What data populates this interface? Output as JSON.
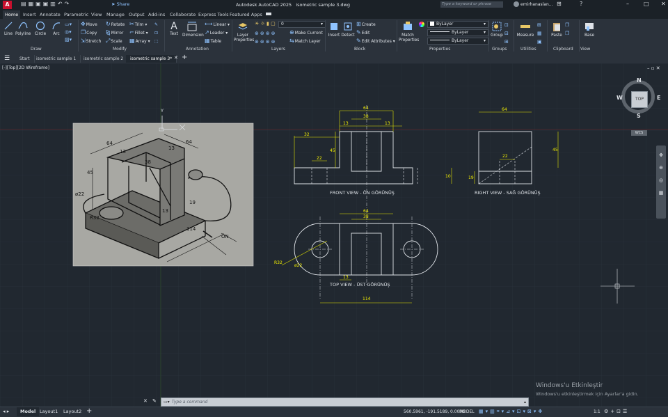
{
  "titlebar": {
    "app_title": "Autodesk AutoCAD 2025",
    "file_name": "isometric sample 3.dwg",
    "share_label": "Share",
    "search_placeholder": "Type a keyword or phrase",
    "user": "emirhanaslan..."
  },
  "ribbon_tabs": [
    "Home",
    "Insert",
    "Annotate",
    "Parametric",
    "View",
    "Manage",
    "Output",
    "Add-ins",
    "Collaborate",
    "Express Tools",
    "Featured Apps"
  ],
  "active_ribbon_tab": "Home",
  "draw": {
    "line": "Line",
    "polyline": "Polyline",
    "circle": "Circle",
    "arc": "Arc",
    "panel": "Draw"
  },
  "modify": {
    "move": "Move",
    "rotate": "Rotate",
    "trim": "Trim",
    "copy": "Copy",
    "mirror": "Mirror",
    "fillet": "Fillet",
    "stretch": "Stretch",
    "scale": "Scale",
    "array": "Array",
    "panel": "Modify"
  },
  "annotation": {
    "text": "Text",
    "dimension": "Dimension",
    "linear": "Linear",
    "leader": "Leader",
    "table": "Table",
    "panel": "Annotation"
  },
  "layers": {
    "layer_properties_1": "Layer",
    "layer_properties_2": "Properties",
    "current_layer": "0",
    "make_current": "Make Current",
    "match_layer": "Match Layer",
    "panel": "Layers"
  },
  "block": {
    "insert": "Insert",
    "detect": "Detect",
    "create": "Create",
    "edit": "Edit",
    "edit_attributes": "Edit Attributes",
    "panel": "Block"
  },
  "properties": {
    "match_1": "Match",
    "match_2": "Properties",
    "color": "ByLayer",
    "linetype": "ByLayer",
    "lineweight": "ByLayer",
    "panel": "Properties"
  },
  "groups": {
    "group": "Group",
    "panel": "Groups"
  },
  "utilities": {
    "measure": "Measure",
    "panel": "Utilities"
  },
  "clipboard": {
    "paste": "Paste",
    "panel": "Clipboard"
  },
  "view_panel": {
    "base": "Base",
    "panel": "View"
  },
  "doc_tabs": [
    "Start",
    "isometric sample 1",
    "isometric sample 2",
    "isometric sample 3*"
  ],
  "active_doc_tab": "isometric sample 3*",
  "viewport_label": "[-][Top][2D Wireframe]",
  "viewcube": {
    "top": "TOP",
    "n": "N",
    "s": "S",
    "e": "E",
    "w": "W",
    "wcs": "WCS"
  },
  "drawing": {
    "front_view": "FRONT VIEW - ÖN GÖRÜNÜŞ",
    "right_view": "RIGHT VIEW - SAĞ GÖRÜNÜŞ",
    "top_view": "TOP VIEW - ÜST GÖRÜNÜŞ",
    "dims_front": {
      "d64": "64",
      "d38": "38",
      "d13a": "13",
      "d13b": "13",
      "d32": "32",
      "d45": "45",
      "d22": "22",
      "d10": "10"
    },
    "dims_right": {
      "d64": "64",
      "d45": "45",
      "d22": "22",
      "d19": "19"
    },
    "dims_top": {
      "d64": "64",
      "d38": "38",
      "d13": "13",
      "d114": "114",
      "r32": "R32",
      "phi22": "ø22"
    },
    "iso_dims": {
      "d64a": "64",
      "d13a": "13",
      "d38": "38",
      "d13b": "13",
      "d64b": "64",
      "d45": "45",
      "phi22": "ø22",
      "r32": "R32",
      "d13c": "13",
      "d19": "19",
      "d114": "114",
      "on": "ÖN"
    }
  },
  "command_placeholder": "Type a command",
  "watermark": {
    "line1": "Windows'u Etkinleştir",
    "line2": "Windows'u etkinleştirmek için Ayarlar'a gidin."
  },
  "layout_tabs": [
    "Model",
    "Layout1",
    "Layout2"
  ],
  "status": {
    "coords": "560.5961, -191.5189, 0.0000",
    "mode": "MODEL",
    "scale": "1:1"
  }
}
